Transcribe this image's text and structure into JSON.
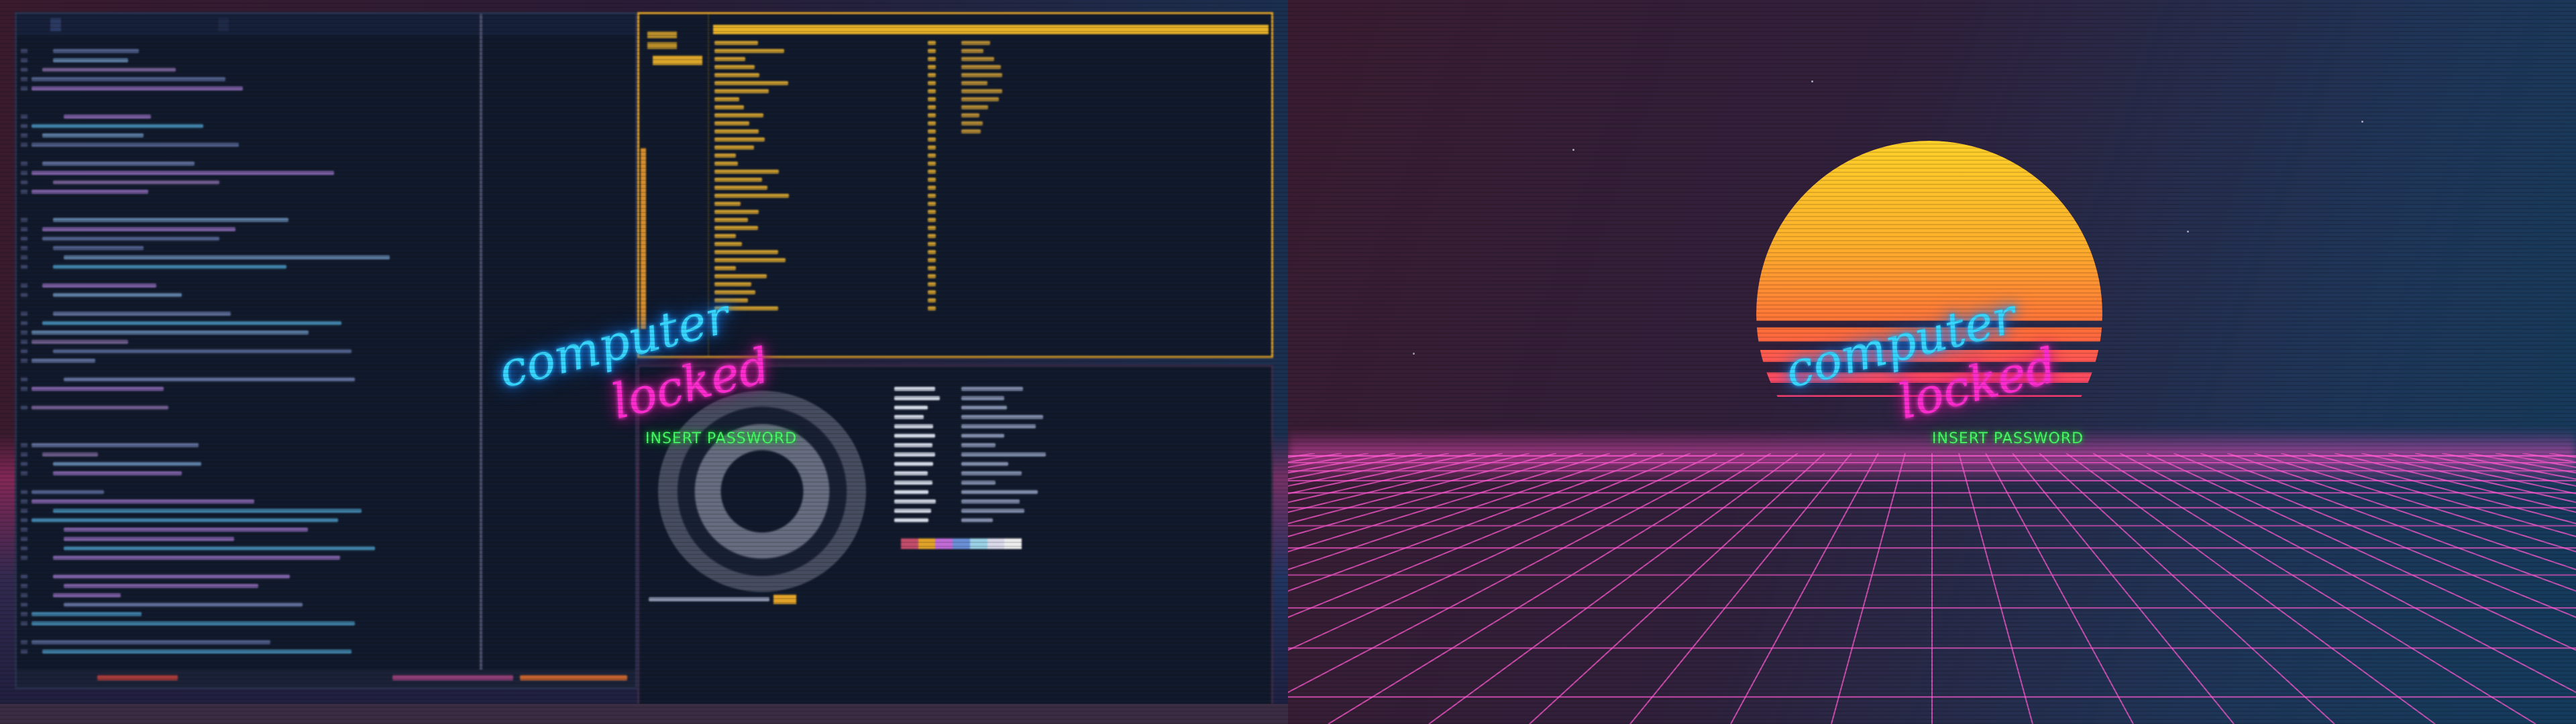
{
  "lock_screen": {
    "title_word_1": "computer",
    "title_word_2": "locked",
    "password_prompt": "INSERT PASSWORD",
    "title_word_1_color": "#38d6ff",
    "title_word_2_color": "#ff2ccf",
    "prompt_color": "#4bff6a"
  },
  "left_monitor": {
    "editor": {
      "tab_1": "",
      "tab_2": ""
    },
    "file_manager": {
      "path": "",
      "footer": ""
    }
  },
  "right_monitor": {
    "wallpaper": "synthwave-sun-grid",
    "sun_colors": [
      "#ffd12a",
      "#ff6d3a",
      "#ff2e82"
    ],
    "grid_color": "#ff5ad2"
  }
}
